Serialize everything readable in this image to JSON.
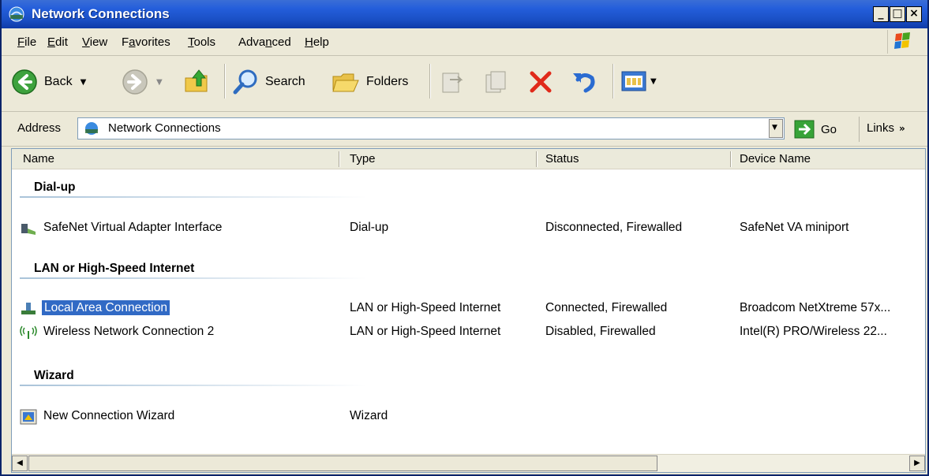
{
  "window": {
    "title": "Network Connections"
  },
  "controls": {
    "minimize": "_",
    "maximize": "□",
    "close": "×"
  },
  "menu": {
    "items": [
      "File",
      "Edit",
      "View",
      "Favorites",
      "Tools",
      "Advanced",
      "Help"
    ],
    "accel": [
      "F",
      "E",
      "V",
      "a",
      "T",
      "n",
      "H"
    ]
  },
  "toolbar": {
    "back": "Back",
    "search": "Search",
    "folders": "Folders"
  },
  "address": {
    "label": "Address",
    "value": "Network Connections",
    "go": "Go",
    "links": "Links"
  },
  "columns": [
    "Name",
    "Type",
    "Status",
    "Device Name"
  ],
  "groups": {
    "dialup": "Dial-up",
    "lan": "LAN or High-Speed Internet",
    "wizard": "Wizard"
  },
  "rows": [
    {
      "name": "SafeNet Virtual Adapter Interface",
      "type": "Dial-up",
      "status": "Disconnected, Firewalled",
      "device": "SafeNet VA miniport"
    },
    {
      "name": "Local Area Connection",
      "type": "LAN or High-Speed Internet",
      "status": "Connected, Firewalled",
      "device": "Broadcom NetXtreme 57x..."
    },
    {
      "name": "Wireless Network Connection 2",
      "type": "LAN or High-Speed Internet",
      "status": "Disabled, Firewalled",
      "device": "Intel(R) PRO/Wireless 22..."
    },
    {
      "name": "New Connection Wizard",
      "type": "Wizard",
      "status": "",
      "device": ""
    }
  ],
  "colors": {
    "titlebar": "#245edb",
    "selection": "#316ac5",
    "chrome": "#ece9d8"
  }
}
